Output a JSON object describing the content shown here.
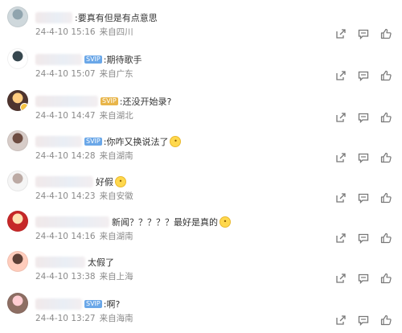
{
  "comments": [
    {
      "name_blur": 46,
      "vip": "",
      "text": ":要真有但是有点意思",
      "emoji": false,
      "date": "24-4-10",
      "time": "15:16",
      "location": "来自四川"
    },
    {
      "name_blur": 58,
      "vip": "blue",
      "vip_text": "SVIP",
      "text": ":期待歌手",
      "emoji": false,
      "date": "24-4-10",
      "time": "15:07",
      "location": "来自广东"
    },
    {
      "name_blur": 78,
      "vip": "gold",
      "vip_text": "SVIP",
      "text": ":还没开始录?",
      "emoji": false,
      "date": "24-4-10",
      "time": "14:47",
      "location": "来自湖北"
    },
    {
      "name_blur": 58,
      "vip": "blue",
      "vip_text": "SVIP",
      "text": ":你咋又换说法了",
      "emoji": true,
      "date": "24-4-10",
      "time": "14:28",
      "location": "来自湖南"
    },
    {
      "name_blur": 72,
      "vip": "",
      "text": "好假",
      "emoji": true,
      "date": "24-4-10",
      "time": "14:23",
      "location": "来自安徽"
    },
    {
      "name_blur": 92,
      "vip": "",
      "text": "新闻？？？？？最好是真的",
      "emoji": true,
      "date": "24-4-10",
      "time": "14:16",
      "location": "来自湖南"
    },
    {
      "name_blur": 62,
      "vip": "",
      "text": "太假了",
      "emoji": false,
      "date": "24-4-10",
      "time": "13:38",
      "location": "来自上海"
    },
    {
      "name_blur": 58,
      "vip": "blue",
      "vip_text": "SVIP",
      "text": ":啊?",
      "emoji": false,
      "date": "24-4-10",
      "time": "13:27",
      "location": "来自海南"
    }
  ],
  "icons": {
    "share": "share-icon",
    "comment": "comment-icon",
    "like": "like-icon"
  },
  "colors": {
    "meta_text": "#8a8a8a",
    "vip_blue": "#6aa7e8",
    "vip_gold": "#e8b54a"
  }
}
